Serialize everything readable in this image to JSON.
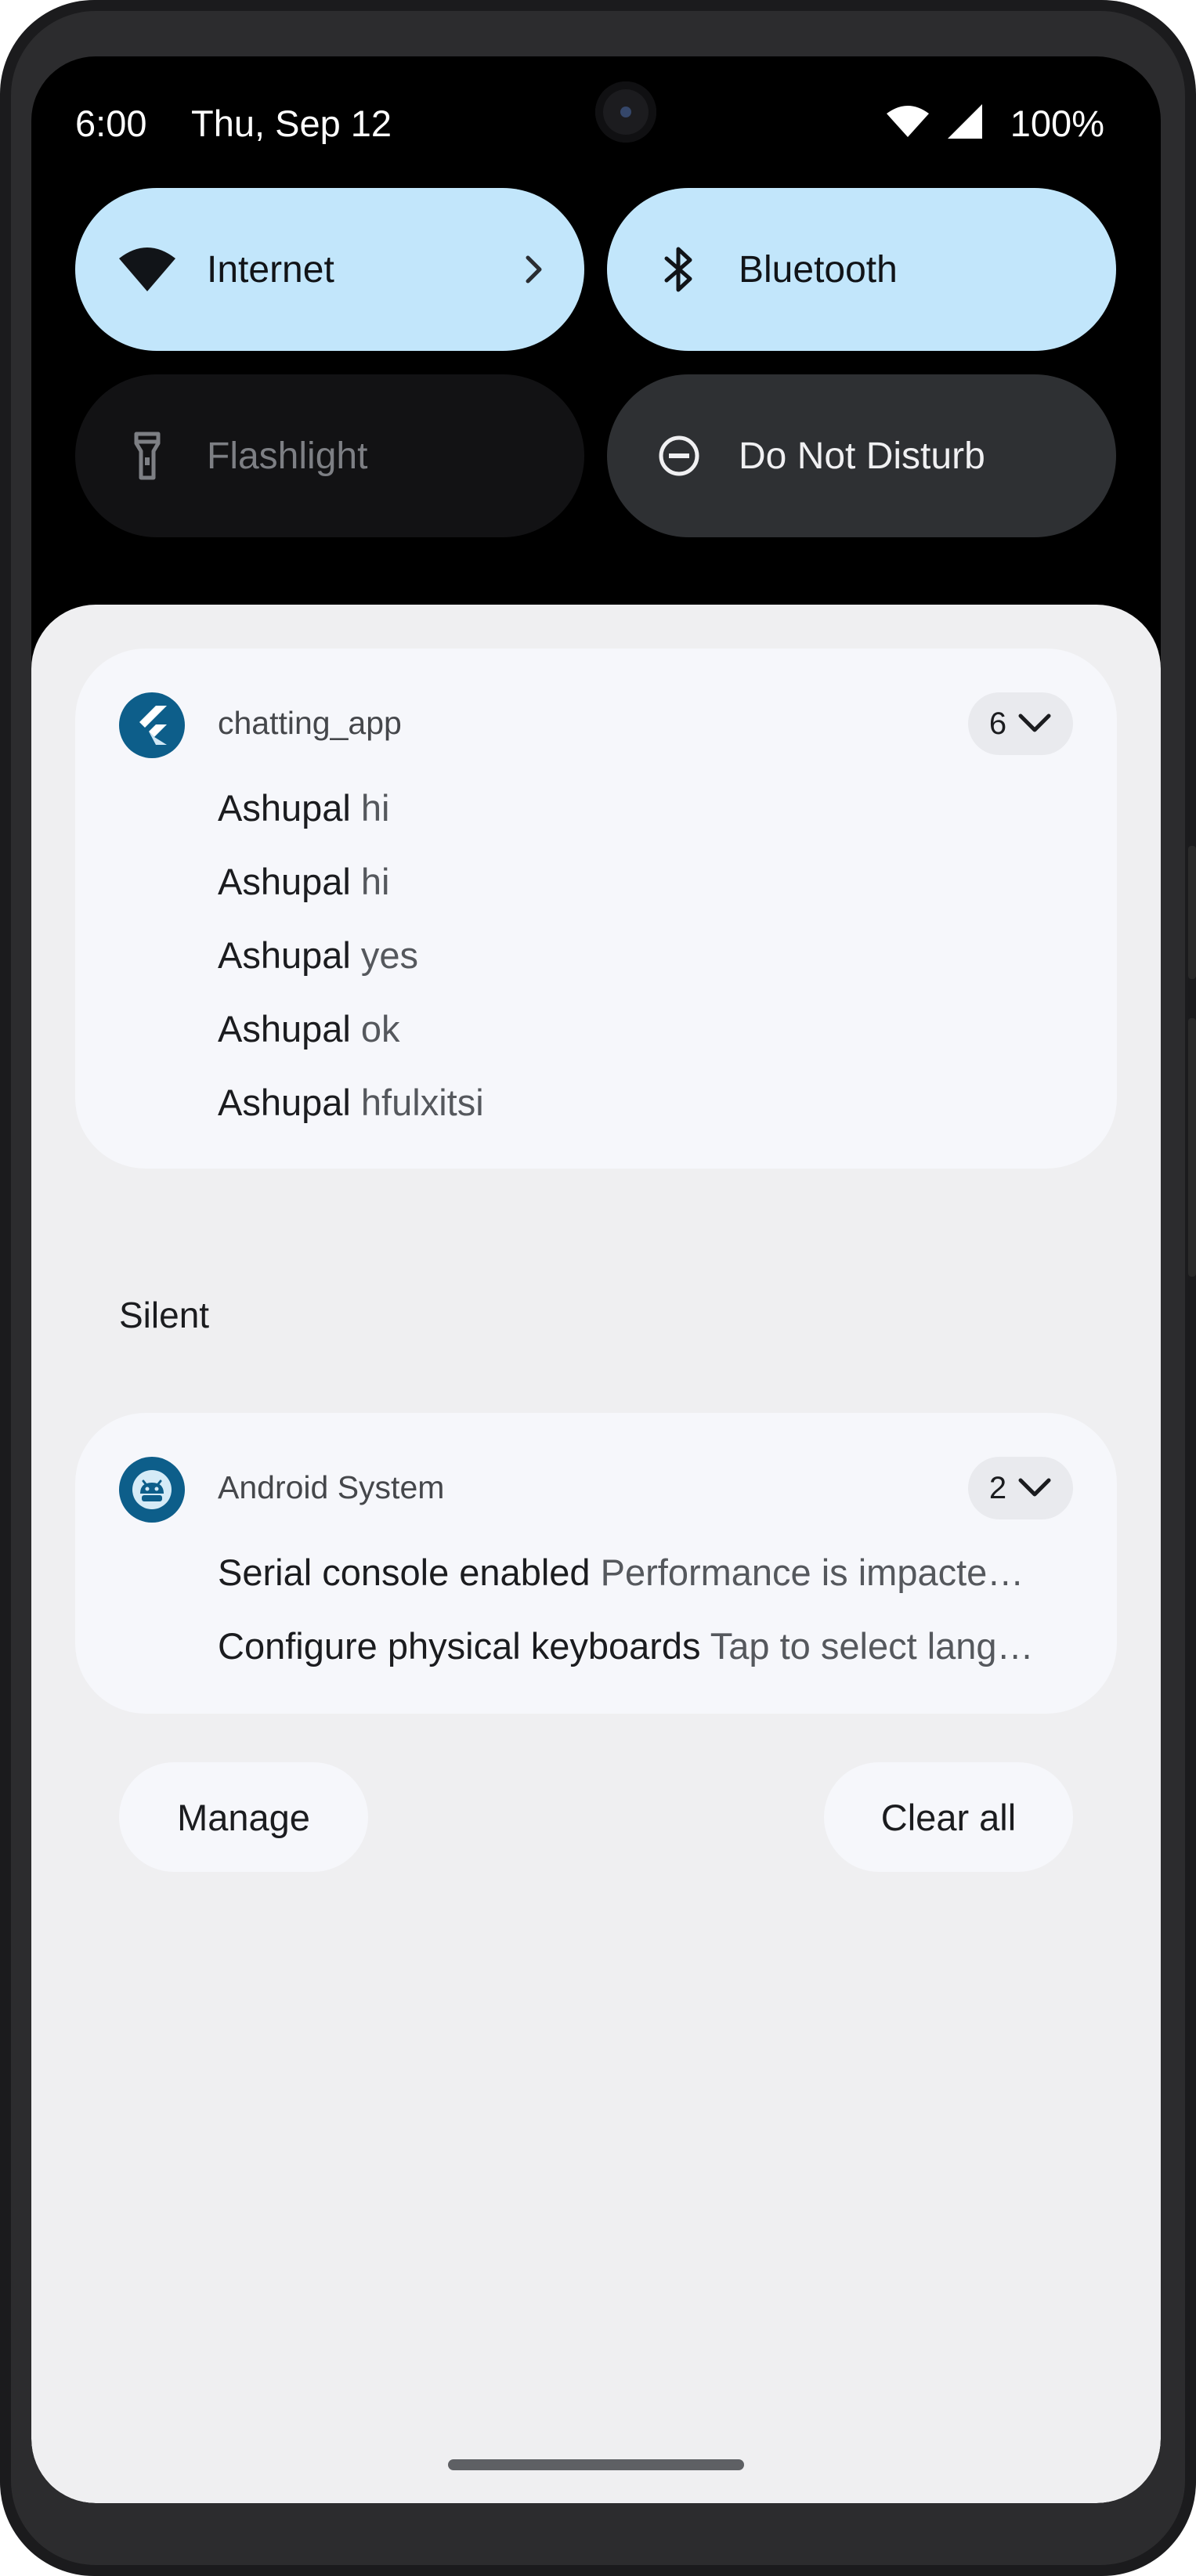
{
  "status_bar": {
    "time": "6:00",
    "date": "Thu, Sep 12",
    "battery": "100%"
  },
  "quick_settings": {
    "tiles": [
      {
        "label": "Internet",
        "icon": "wifi-icon",
        "state": "on"
      },
      {
        "label": "Bluetooth",
        "icon": "bluetooth-icon",
        "state": "on"
      },
      {
        "label": "Flashlight",
        "icon": "flashlight-icon",
        "state": "off"
      },
      {
        "label": "Do Not Disturb",
        "icon": "do-not-disturb-icon",
        "state": "off"
      }
    ]
  },
  "notifications": {
    "chat_group": {
      "app_name": "chatting_app",
      "count": "6",
      "messages": [
        {
          "sender": "Ashupal",
          "text": "hi"
        },
        {
          "sender": "Ashupal",
          "text": "hi"
        },
        {
          "sender": "Ashupal",
          "text": "yes"
        },
        {
          "sender": "Ashupal",
          "text": "ok"
        },
        {
          "sender": "Ashupal",
          "text": "hfulxitsi"
        }
      ]
    },
    "silent_header": "Silent",
    "system_group": {
      "app_name": "Android System",
      "count": "2",
      "items": [
        {
          "title": "Serial console enabled",
          "body": "Performance is impacte…"
        },
        {
          "title": "Configure physical keyboards",
          "body": "Tap to select lang…"
        }
      ]
    }
  },
  "actions": {
    "manage_label": "Manage",
    "clear_all_label": "Clear all"
  },
  "colors": {
    "tile_active": "#c2e6fb",
    "tile_off": "#121214",
    "tile_dnd": "#2e3033",
    "shade_bg": "#efeff1",
    "card_bg": "#f6f7fb",
    "app_icon": "#0d5e8a"
  }
}
